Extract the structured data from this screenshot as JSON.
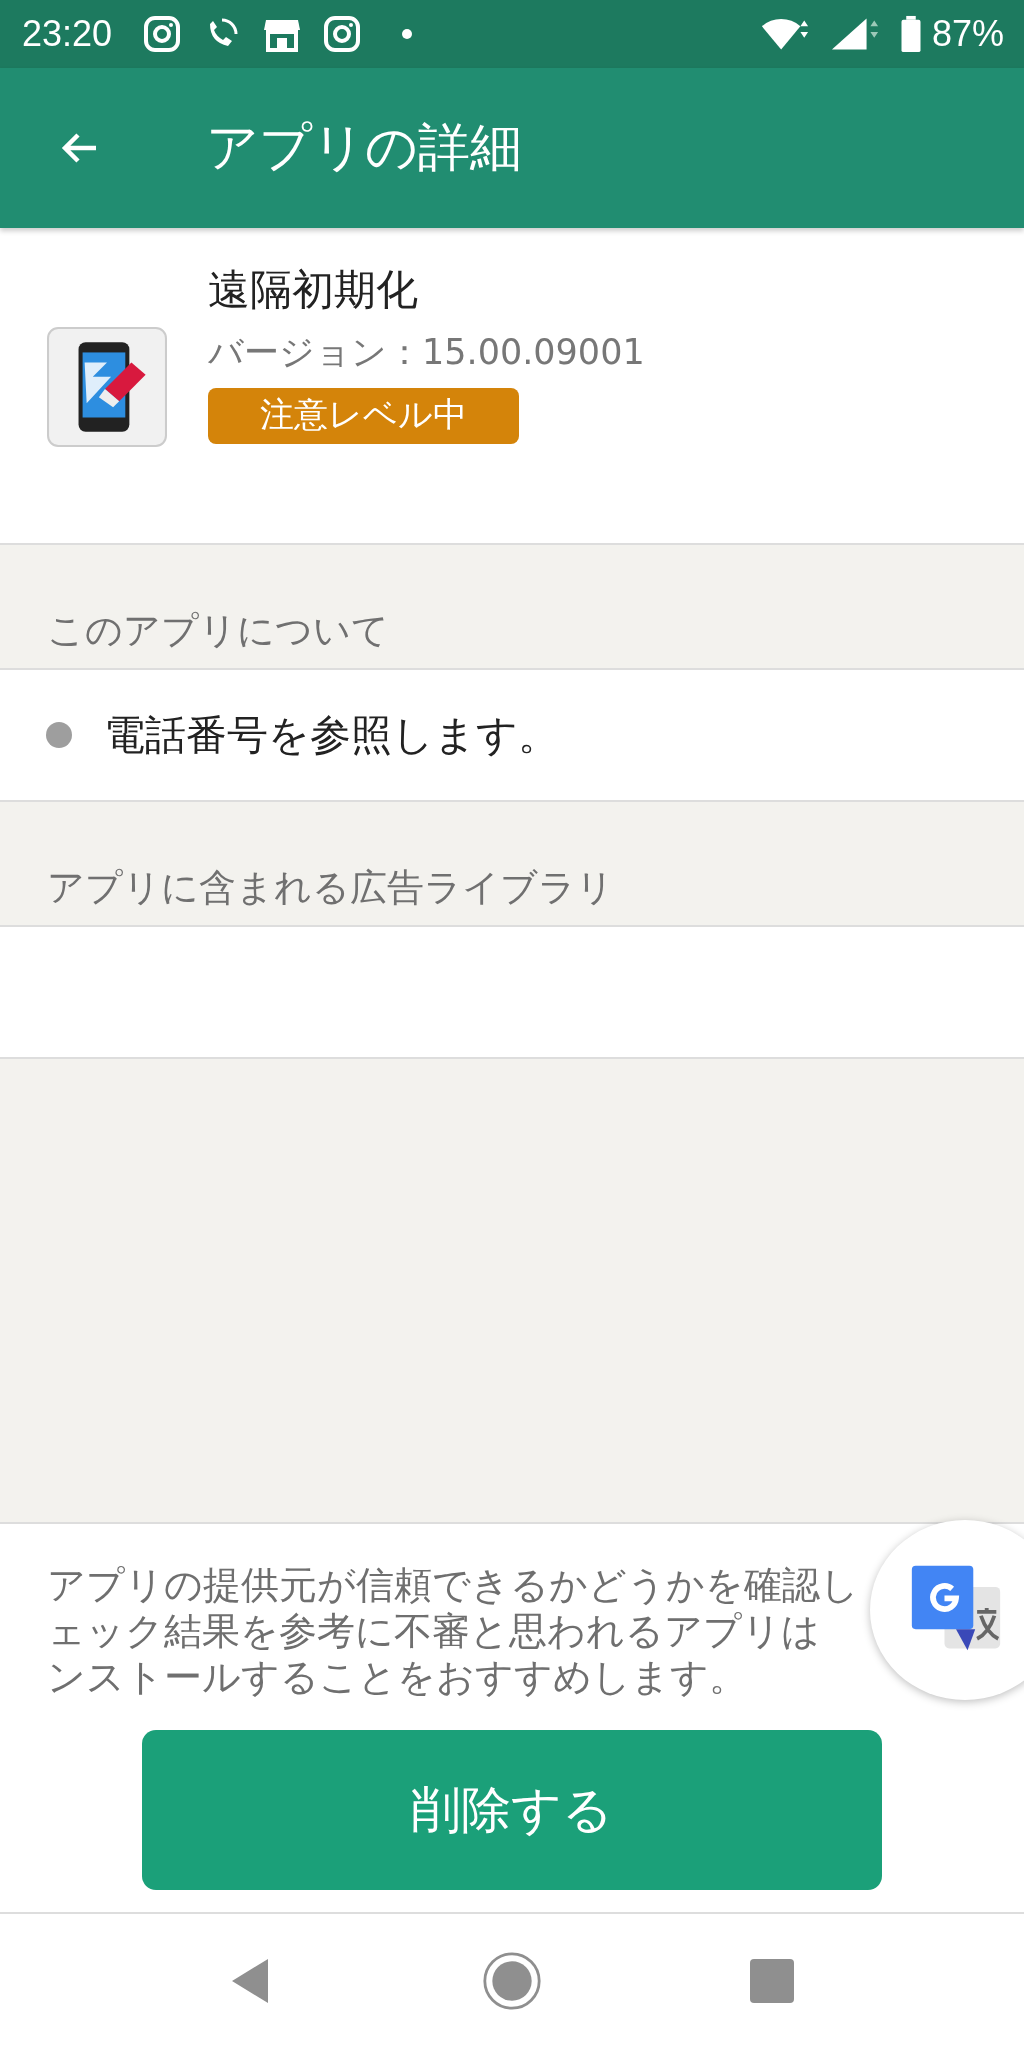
{
  "status_bar": {
    "time": "23:20",
    "battery": "87%"
  },
  "header": {
    "title": "アプリの詳細"
  },
  "app": {
    "name": "遠隔初期化",
    "version": "バージョン：15.00.09001",
    "badge": "注意レベル中"
  },
  "sections": [
    {
      "heading": "このアプリについて",
      "items": [
        "電話番号を参照します。"
      ]
    },
    {
      "heading": "アプリに含まれる広告ライブラリ"
    }
  ],
  "notice": {
    "lines": [
      "アプリの提供元が信頼できるかどうかを確認し",
      "ェック結果を参考に不審と思われるアプリは",
      "ンストールすることをおすすめします。"
    ]
  },
  "delete_button": {
    "label": "削除する"
  }
}
